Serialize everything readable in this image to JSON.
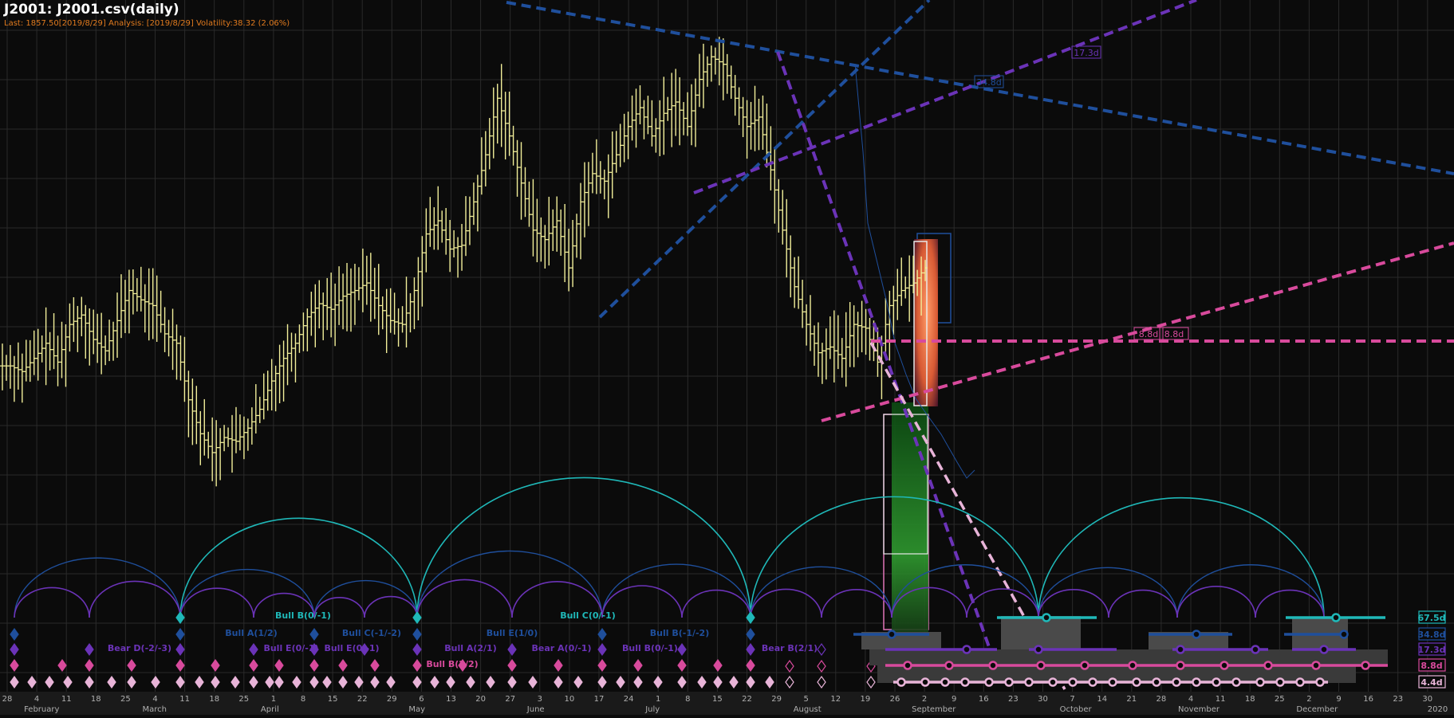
{
  "header": {
    "title": "J2001: J2001.csv(daily)",
    "subtitle": "Last: 1857.50[2019/8/29] Analysis: [2019/8/29] Volatility:38.32 (2.06%)"
  },
  "colors": {
    "background": "#0b0b0b",
    "grid": "#2a2a2a",
    "price_bars": "#f2ef9a",
    "cycle_67": "#1fb8b8",
    "cycle_34": "#1f4f9c",
    "cycle_17": "#6b33b8",
    "cycle_8": "#d84a9c",
    "cycle_4": "#e8b4d8"
  },
  "chart_data": {
    "type": "ohlc",
    "x_axis": {
      "months": [
        "February",
        "March",
        "April",
        "May",
        "June",
        "July",
        "August",
        "September",
        "October",
        "November",
        "December",
        "2020"
      ],
      "ticks": [
        "28",
        "4",
        "11",
        "18",
        "25",
        "4",
        "11",
        "18",
        "25",
        "1",
        "8",
        "15",
        "22",
        "29",
        "6",
        "13",
        "20",
        "27",
        "3",
        "10",
        "17",
        "24",
        "1",
        "8",
        "15",
        "22",
        "29",
        "5",
        "12",
        "19",
        "26",
        "2",
        "9",
        "16",
        "23",
        "30",
        "7",
        "14",
        "21",
        "28",
        "4",
        "11",
        "18",
        "25",
        "2",
        "9",
        "16",
        "23",
        "30"
      ]
    },
    "price_close_series": [
      1808,
      1805,
      1812,
      1820,
      1810,
      1830,
      1835,
      1822,
      1816,
      1832,
      1848,
      1843,
      1840,
      1825,
      1820,
      1790,
      1772,
      1762,
      1770,
      1768,
      1775,
      1785,
      1800,
      1812,
      1820,
      1834,
      1841,
      1838,
      1845,
      1848,
      1852,
      1840,
      1832,
      1830,
      1848,
      1878,
      1885,
      1870,
      1872,
      1895,
      1920,
      1950,
      1930,
      1905,
      1880,
      1875,
      1885,
      1860,
      1895,
      1910,
      1906,
      1920,
      1935,
      1945,
      1930,
      1942,
      1948,
      1935,
      1960,
      1972,
      1968,
      1950,
      1935,
      1940,
      1912,
      1880,
      1850,
      1830,
      1815,
      1818,
      1812,
      1830,
      1828,
      1810,
      1840,
      1848,
      1852,
      1860
    ],
    "cycle_labels": [
      {
        "text": "Bull B(0/-1)",
        "color": "#1fb8b8"
      },
      {
        "text": "Bull C(0/-1)",
        "color": "#1fb8b8"
      },
      {
        "text": "Bull A(1/2)",
        "color": "#1f4f9c"
      },
      {
        "text": "Bull C(-1/-2)",
        "color": "#1f4f9c"
      },
      {
        "text": "Bull E(1/0)",
        "color": "#1f4f9c"
      },
      {
        "text": "Bull B(-1/-2)",
        "color": "#1f4f9c"
      },
      {
        "text": "Bear D(-2/-3)",
        "color": "#6b33b8"
      },
      {
        "text": "Bull E(0/-1)",
        "color": "#6b33b8"
      },
      {
        "text": "Bull E(0/-1)",
        "color": "#6b33b8"
      },
      {
        "text": "Bull A(2/1)",
        "color": "#6b33b8"
      },
      {
        "text": "Bear A(0/-1)",
        "color": "#6b33b8"
      },
      {
        "text": "Bull B(0/-1)",
        "color": "#6b33b8"
      },
      {
        "text": "Bear B(2/1)",
        "color": "#6b33b8"
      },
      {
        "text": "Bull B(2/2)",
        "color": "#d84a9c"
      }
    ],
    "trendline_labels": [
      {
        "text": "17.3d",
        "color": "#6b33b8"
      },
      {
        "text": "34.8d",
        "color": "#1f4f9c"
      },
      {
        "text": "8.8d",
        "color": "#d84a9c"
      },
      {
        "text": "8.8d",
        "color": "#d84a9c"
      }
    ],
    "cycle_legend": [
      {
        "label": "67.5d",
        "color": "#1fb8b8"
      },
      {
        "label": "34.8d",
        "color": "#1f4f9c"
      },
      {
        "label": "17.3d",
        "color": "#6b33b8"
      },
      {
        "label": "8.8d",
        "color": "#d84a9c"
      },
      {
        "label": "4.4d",
        "color": "#e8b4d8"
      }
    ]
  }
}
